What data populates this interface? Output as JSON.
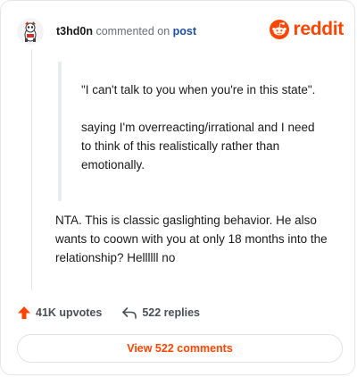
{
  "header": {
    "username": "t3hd0n",
    "commented_text": "commented on",
    "post_link": "post",
    "brand": "reddit"
  },
  "quote": {
    "paragraphs": [
      "\"I can't talk to you when you're in this state\".",
      "saying I'm overreacting/irrational and I need to think of this realistically rather than emotionally."
    ]
  },
  "comment": {
    "text": "NTA. This is classic gaslighting behavior. He also wants to coown with you at only 18 months into the relationship? Hellllll no"
  },
  "actions": {
    "upvotes": "41K upvotes",
    "replies": "522 replies"
  },
  "view_button": "View 522 comments",
  "colors": {
    "brand": "#ff4500",
    "post_link": "#1d4fa0",
    "text": "#1a1a1b"
  }
}
